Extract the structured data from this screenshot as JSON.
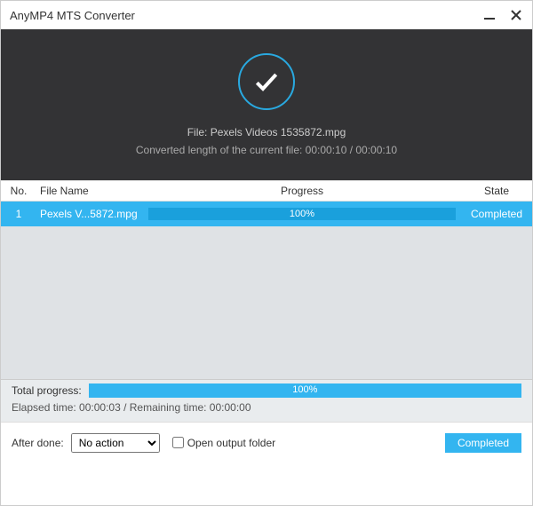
{
  "window": {
    "title": "AnyMP4 MTS Converter"
  },
  "hero": {
    "file_line": "File: Pexels Videos 1535872.mpg",
    "length_line": "Converted length of the current file: 00:00:10 / 00:00:10"
  },
  "table": {
    "headers": {
      "no": "No.",
      "name": "File Name",
      "progress": "Progress",
      "state": "State"
    },
    "rows": [
      {
        "no": "1",
        "name": "Pexels V...5872.mpg",
        "progress_label": "100%",
        "progress_pct": 100,
        "state": "Completed"
      }
    ]
  },
  "total": {
    "label": "Total progress:",
    "progress_label": "100%",
    "progress_pct": 100,
    "times": "Elapsed time: 00:00:03 / Remaining time: 00:00:00"
  },
  "footer": {
    "after_label": "After done:",
    "after_value": "No action",
    "open_folder": "Open output folder",
    "completed_btn": "Completed"
  }
}
